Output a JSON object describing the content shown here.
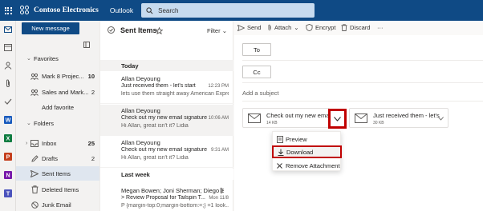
{
  "topbar": {
    "brand": "Contoso Electronics",
    "app": "Outlook",
    "search_placeholder": "Search"
  },
  "rail": {
    "icons": [
      "mail-icon",
      "calendar-icon",
      "people-icon",
      "attach-icon",
      "todo-icon",
      "word-icon",
      "excel-icon",
      "powerpoint-icon",
      "onenote-icon",
      "teams-icon"
    ]
  },
  "folders": {
    "new_message": "New message",
    "favorites_label": "Favorites",
    "favorites": [
      {
        "label": "Mark 8 Projec...",
        "count": "10"
      },
      {
        "label": "Sales and Mark...",
        "count": "2"
      }
    ],
    "add_favorite": "Add favorite",
    "folders_label": "Folders",
    "items": [
      {
        "label": "Inbox",
        "count": "25"
      },
      {
        "label": "Drafts",
        "count": "2"
      },
      {
        "label": "Sent Items",
        "count": ""
      },
      {
        "label": "Deleted Items",
        "count": ""
      },
      {
        "label": "Junk Email",
        "count": ""
      }
    ]
  },
  "list": {
    "title": "Sent Items",
    "filter": "Filter",
    "groups": {
      "today": "Today",
      "last_week": "Last week"
    },
    "messages": [
      {
        "from": "Allan Deyoung",
        "subject": "Just received them - let's start",
        "preview": "lets use them straight away American Expre...",
        "time": "12:23 PM"
      },
      {
        "from": "Allan Deyoung",
        "subject": "Check out my new email signature",
        "preview": "Hi Allan, great isn't it? Lidia",
        "time": "10:06 AM"
      },
      {
        "from": "Allan Deyoung",
        "subject": "Check out my new email signature",
        "preview": "Hi Allan, great isn't it? Lidia",
        "time": "9:31 AM"
      },
      {
        "from": "Megan Bowen; Joni Sherman; Diego S...",
        "subject": "> Review Proposal for Tailspin T...",
        "preview": "P {margin-top:0;margin-bottom:=;} =1 look...",
        "time": "Mon 11/8"
      }
    ]
  },
  "compose": {
    "commands": {
      "send": "Send",
      "attach": "Attach",
      "encrypt": "Encrypt",
      "discard": "Discard",
      "more": "···"
    },
    "to": "To",
    "cc": "Cc",
    "subject_placeholder": "Add a subject",
    "attachments": [
      {
        "name": "Check out my new email ...",
        "size": "14 KB"
      },
      {
        "name": "Just received them - let's st...",
        "size": "30 KB"
      }
    ],
    "menu": {
      "preview": "Preview",
      "download": "Download",
      "remove": "Remove Attachment"
    }
  },
  "colors": {
    "brand": "#0f4a85",
    "highlight": "#c00000",
    "accent": "#0078d4"
  }
}
